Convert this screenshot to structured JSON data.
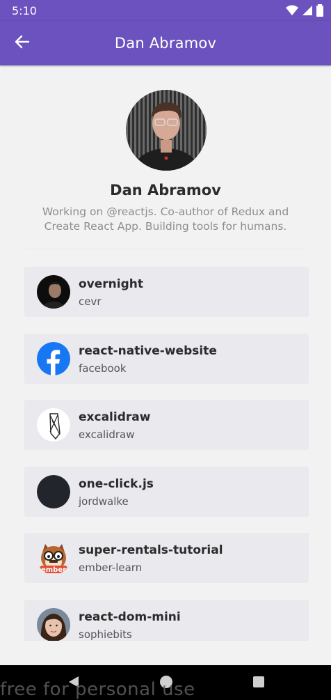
{
  "status_bar": {
    "time": "5:10",
    "icons": [
      "wifi-icon",
      "signal-icon",
      "battery-icon"
    ]
  },
  "app_bar": {
    "back_icon": "arrow-back-icon",
    "title": "Dan Abramov"
  },
  "profile": {
    "name": "Dan Abramov",
    "bio": "Working on @reactjs. Co-author of Redux and Create React App. Building tools for humans."
  },
  "repos": [
    {
      "name": "overnight",
      "owner": "cevr"
    },
    {
      "name": "react-native-website",
      "owner": "facebook"
    },
    {
      "name": "excalidraw",
      "owner": "excalidraw"
    },
    {
      "name": "one-click.js",
      "owner": "jordwalke"
    },
    {
      "name": "super-rentals-tutorial",
      "owner": "ember-learn"
    },
    {
      "name": "react-dom-mini",
      "owner": "sophiebits"
    }
  ],
  "nav_bar": {
    "buttons": [
      "back-triangle-icon",
      "home-circle-icon",
      "recents-square-icon"
    ]
  },
  "watermark": "free for personal use",
  "colors": {
    "accent": "#6c52be",
    "background": "#f2f2f2",
    "card": "#e9e9ee",
    "facebook_blue": "#1877f2"
  }
}
